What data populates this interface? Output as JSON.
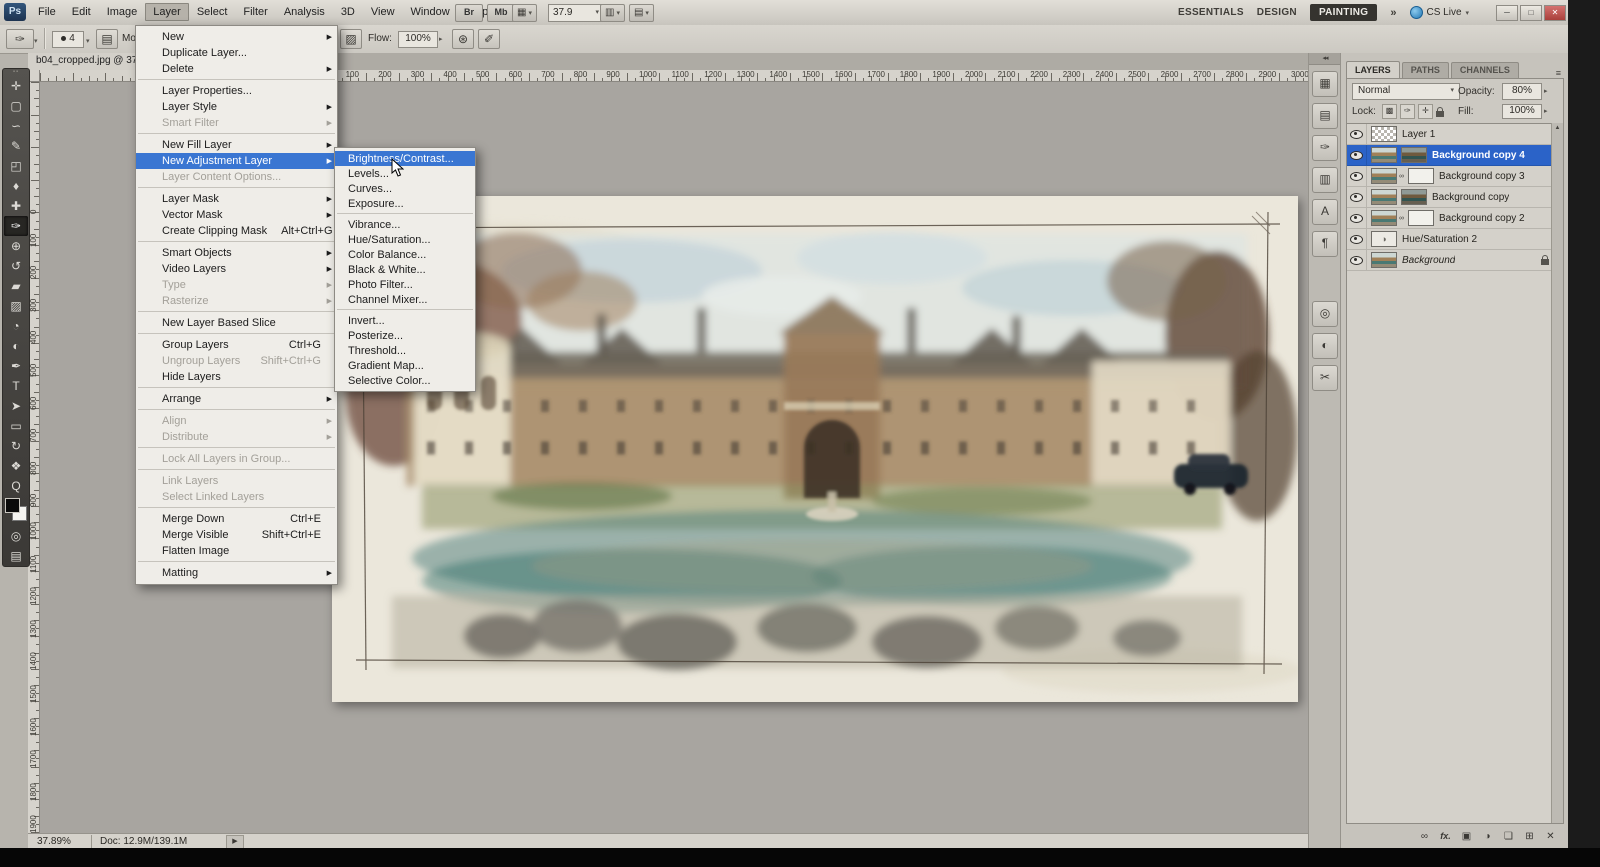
{
  "colors": {
    "menu_highlight": "#3a76d2",
    "selected_layer": "#2b63c8",
    "workspace_active_bg": "#35332f",
    "close_button_red": "#a93f3a",
    "cs_live_blue": "#2f8fce",
    "panel_bg": "#c6c3bc",
    "canvas_bg": "#a8a5a0"
  },
  "icons": {
    "dropdown_arrow": "▾",
    "submenu_arrow": "▶",
    "spinner_arrow": "▸",
    "collapse_dock": "◂◂",
    "panel_menu": "≡",
    "flyout_arrow": "▶",
    "scroll_up": "▲"
  },
  "menubar": {
    "logo": "Ps",
    "items": [
      {
        "label": "File"
      },
      {
        "label": "Edit"
      },
      {
        "label": "Image"
      },
      {
        "label": "Layer",
        "active": true
      },
      {
        "label": "Select"
      },
      {
        "label": "Filter"
      },
      {
        "label": "Analysis"
      },
      {
        "label": "3D"
      },
      {
        "label": "View"
      },
      {
        "label": "Window"
      },
      {
        "label": "Help"
      }
    ],
    "quick_buttons": [
      {
        "name": "bridge-button",
        "label": "Br"
      },
      {
        "name": "mini-bridge-button",
        "label": "Mb"
      }
    ],
    "view_buttons_left": [
      {
        "name": "view-extras-button",
        "glyph": "▦"
      }
    ],
    "zoom_value": "37.9",
    "view_buttons_right": [
      {
        "name": "arrange-documents-button",
        "glyph": "▥"
      },
      {
        "name": "screen-mode-button",
        "glyph": "▤"
      }
    ],
    "workspaces": [
      {
        "label": "ESSENTIALS"
      },
      {
        "label": "DESIGN"
      },
      {
        "label": "PAINTING",
        "active": true
      }
    ],
    "overflow": "»",
    "cs_live": "CS Live",
    "window_buttons": [
      {
        "name": "minimize-button",
        "glyph": "─"
      },
      {
        "name": "restore-button",
        "glyph": "□"
      },
      {
        "name": "close-button",
        "glyph": "✕",
        "red": true
      }
    ]
  },
  "options_bar": {
    "tool_glyph": "✑",
    "brush_value": "4",
    "mode_label": "Mode:",
    "brush_panel_glyph": "▨",
    "flow_label": "Flow:",
    "flow_value": "100%",
    "airbrush_glyph": "⊛",
    "tablet_glyph": "✐"
  },
  "document": {
    "tab_title": "b04_cropped.jpg @ 37...",
    "zoom_status": "37.89%",
    "doc_size": "Doc: 12.9M/139.1M"
  },
  "rulers": {
    "horizontal": {
      "from": 0,
      "to": 3000,
      "step": 100
    },
    "vertical": {
      "from": 0,
      "to": 1900,
      "step": 100
    }
  },
  "tools": [
    {
      "name": "move-tool",
      "glyph": "✛"
    },
    {
      "name": "marquee-tool",
      "glyph": "▢"
    },
    {
      "name": "lasso-tool",
      "glyph": "∽"
    },
    {
      "name": "quick-selection-tool",
      "glyph": "✎"
    },
    {
      "name": "crop-tool",
      "glyph": "◰"
    },
    {
      "name": "eyedropper-tool",
      "glyph": "♦"
    },
    {
      "name": "healing-brush-tool",
      "glyph": "✚"
    },
    {
      "name": "brush-tool",
      "glyph": "✑",
      "selected": true
    },
    {
      "name": "clone-stamp-tool",
      "glyph": "⊕"
    },
    {
      "name": "history-brush-tool",
      "glyph": "↺"
    },
    {
      "name": "eraser-tool",
      "glyph": "▰"
    },
    {
      "name": "gradient-tool",
      "glyph": "▨"
    },
    {
      "name": "blur-tool",
      "glyph": "◔"
    },
    {
      "name": "dodge-tool",
      "glyph": "◐"
    },
    {
      "name": "pen-tool",
      "glyph": "✒"
    },
    {
      "name": "type-tool",
      "glyph": "T"
    },
    {
      "name": "path-selection-tool",
      "glyph": "➤"
    },
    {
      "name": "shape-tool",
      "glyph": "▭"
    },
    {
      "name": "3d-rotate-tool",
      "glyph": "↻"
    },
    {
      "name": "hand-tool",
      "glyph": "❖"
    },
    {
      "name": "zoom-tool",
      "glyph": "Q"
    }
  ],
  "tools_extra": [
    {
      "name": "quick-mask-toggle",
      "glyph": "◎"
    },
    {
      "name": "screen-mode-toggle",
      "glyph": "▤"
    }
  ],
  "layer_menu": {
    "items": [
      {
        "label": "New",
        "arrow": true
      },
      {
        "label": "Duplicate Layer..."
      },
      {
        "label": "Delete",
        "arrow": true
      },
      {
        "sep": true
      },
      {
        "label": "Layer Properties..."
      },
      {
        "label": "Layer Style",
        "arrow": true
      },
      {
        "label": "Smart Filter",
        "arrow": true,
        "disabled": true
      },
      {
        "sep": true
      },
      {
        "label": "New Fill Layer",
        "arrow": true
      },
      {
        "label": "New Adjustment Layer",
        "arrow": true,
        "highlight": true
      },
      {
        "label": "Layer Content Options...",
        "disabled": true
      },
      {
        "sep": true
      },
      {
        "label": "Layer Mask",
        "arrow": true
      },
      {
        "label": "Vector Mask",
        "arrow": true
      },
      {
        "label": "Create Clipping Mask",
        "shortcut": "Alt+Ctrl+G"
      },
      {
        "sep": true
      },
      {
        "label": "Smart Objects",
        "arrow": true
      },
      {
        "label": "Video Layers",
        "arrow": true
      },
      {
        "label": "Type",
        "arrow": true,
        "disabled": true
      },
      {
        "label": "Rasterize",
        "arrow": true,
        "disabled": true
      },
      {
        "sep": true
      },
      {
        "label": "New Layer Based Slice"
      },
      {
        "sep": true
      },
      {
        "label": "Group Layers",
        "shortcut": "Ctrl+G"
      },
      {
        "label": "Ungroup Layers",
        "shortcut": "Shift+Ctrl+G",
        "disabled": true
      },
      {
        "label": "Hide Layers"
      },
      {
        "sep": true
      },
      {
        "label": "Arrange",
        "arrow": true
      },
      {
        "sep": true
      },
      {
        "label": "Align",
        "arrow": true,
        "disabled": true
      },
      {
        "label": "Distribute",
        "arrow": true,
        "disabled": true
      },
      {
        "sep": true
      },
      {
        "label": "Lock All Layers in Group...",
        "disabled": true
      },
      {
        "sep": true
      },
      {
        "label": "Link Layers",
        "disabled": true
      },
      {
        "label": "Select Linked Layers",
        "disabled": true
      },
      {
        "sep": true
      },
      {
        "label": "Merge Down",
        "shortcut": "Ctrl+E"
      },
      {
        "label": "Merge Visible",
        "shortcut": "Shift+Ctrl+E"
      },
      {
        "label": "Flatten Image"
      },
      {
        "sep": true
      },
      {
        "label": "Matting",
        "arrow": true
      }
    ]
  },
  "adjustment_submenu": {
    "items": [
      {
        "label": "Brightness/Contrast...",
        "highlight": true
      },
      {
        "label": "Levels..."
      },
      {
        "label": "Curves..."
      },
      {
        "label": "Exposure..."
      },
      {
        "sep": true
      },
      {
        "label": "Vibrance..."
      },
      {
        "label": "Hue/Saturation..."
      },
      {
        "label": "Color Balance..."
      },
      {
        "label": "Black & White..."
      },
      {
        "label": "Photo Filter..."
      },
      {
        "label": "Channel Mixer..."
      },
      {
        "sep": true
      },
      {
        "label": "Invert..."
      },
      {
        "label": "Posterize..."
      },
      {
        "label": "Threshold..."
      },
      {
        "label": "Gradient Map..."
      },
      {
        "label": "Selective Color..."
      }
    ]
  },
  "dock": {
    "collapse": "◂◂",
    "groups": [
      [
        {
          "name": "mini-bridge-panel-icon",
          "glyph": "▦"
        },
        {
          "name": "histogram-panel-icon",
          "glyph": "▤"
        },
        {
          "name": "brush-presets-panel-icon",
          "glyph": "✑"
        },
        {
          "name": "swatches-panel-icon",
          "glyph": "▥"
        },
        {
          "name": "character-panel-icon",
          "glyph": "A"
        },
        {
          "name": "paragraph-panel-icon",
          "glyph": "¶"
        }
      ],
      [
        {
          "name": "masks-panel-icon",
          "glyph": "◎"
        },
        {
          "name": "adjustments-panel-icon",
          "glyph": "◐"
        },
        {
          "name": "clone-source-panel-icon",
          "glyph": "✂"
        }
      ]
    ]
  },
  "layers_panel": {
    "tabs": [
      {
        "label": "LAYERS",
        "active": true
      },
      {
        "label": "PATHS"
      },
      {
        "label": "CHANNELS"
      }
    ],
    "blend_mode": "Normal",
    "opacity_label": "Opacity:",
    "opacity_value": "80%",
    "lock_label": "Lock:",
    "lock_icons": [
      {
        "name": "lock-transparency-icon",
        "glyph": "▩"
      },
      {
        "name": "lock-pixels-icon",
        "glyph": "✑"
      },
      {
        "name": "lock-position-icon",
        "glyph": "✛"
      },
      {
        "name": "lock-all-icon",
        "css": "mini-lock"
      }
    ],
    "fill_label": "Fill:",
    "fill_value": "100%",
    "layers": [
      {
        "name": "Layer 1",
        "thumb": "checker"
      },
      {
        "name": "Background copy 4",
        "thumb": "art",
        "mask": "art2",
        "selected": true
      },
      {
        "name": "Background copy 3",
        "thumb": "art",
        "mask": "white",
        "link": true
      },
      {
        "name": "Background copy",
        "thumb": "art",
        "mask": "art2"
      },
      {
        "name": "Background copy 2",
        "thumb": "art",
        "mask": "white",
        "link": true
      },
      {
        "name": "Hue/Saturation 2",
        "thumb": "adjust"
      },
      {
        "name": "Background",
        "thumb": "art",
        "italic": true,
        "locked": true
      }
    ],
    "actions": [
      {
        "name": "link-layers-icon",
        "glyph": "∞"
      },
      {
        "name": "layer-style-icon",
        "glyph": "fx.",
        "fx": true
      },
      {
        "name": "add-layer-mask-icon",
        "glyph": "▣"
      },
      {
        "name": "new-adjustment-layer-icon",
        "glyph": "◑"
      },
      {
        "name": "new-group-icon",
        "glyph": "❏"
      },
      {
        "name": "new-layer-icon",
        "glyph": "⊞"
      },
      {
        "name": "delete-layer-icon",
        "glyph": "✕"
      }
    ]
  }
}
